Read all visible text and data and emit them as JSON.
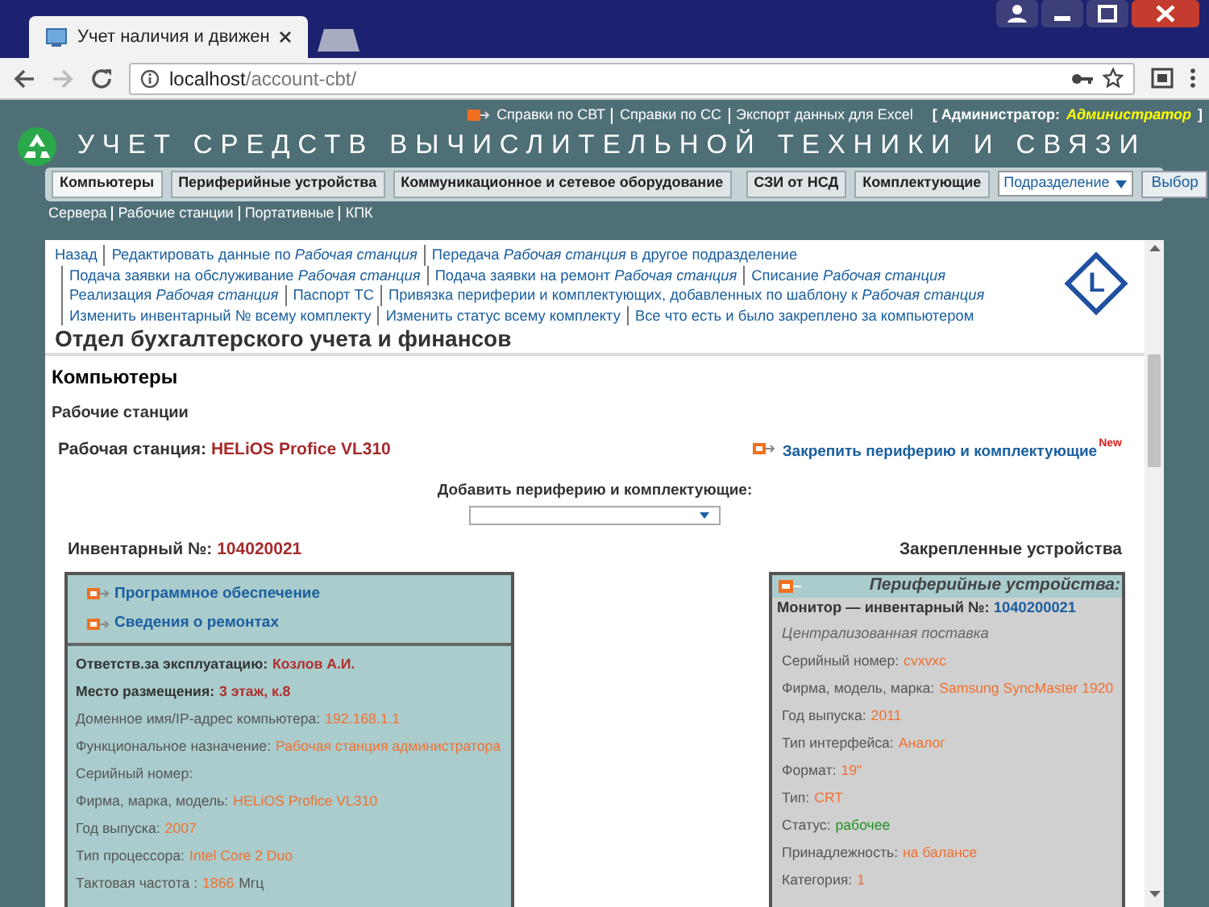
{
  "browser": {
    "tab_title": "Учет наличия и движен",
    "url_host": "localhost",
    "url_path": "/account-cbt/"
  },
  "header": {
    "top_links": [
      "Справки по СВТ",
      "Справки по СС",
      "Экспорт данных для Excel"
    ],
    "admin_label": "[ Администратор:",
    "admin_name": "Администратор",
    "admin_close": "]",
    "title": "УЧЕТ СРЕДСТВ ВЫЧИСЛИТЕЛЬНОЙ ТЕХНИКИ И СВЯЗИ",
    "nav": [
      {
        "label": "Компьютеры",
        "selected": true
      },
      {
        "label": "Периферийные устройства",
        "selected": false
      },
      {
        "label": "Коммуникационное и сетевое оборудование",
        "selected": false
      },
      {
        "label": "СЗИ от НСД",
        "selected": false
      },
      {
        "label": "Комплектующие",
        "selected": false
      }
    ],
    "department_select": "Подразделение",
    "select_button": "Выбор",
    "sublinks": [
      "Сервера",
      "Рабочие станции",
      "Портативные",
      "КПК"
    ]
  },
  "actions": [
    "Назад",
    "Редактировать данные по *Рабочая станция*",
    "Передача *Рабочая станция* в другое подразделение",
    "Подача заявки на обслуживание *Рабочая станция*",
    "Подача заявки на ремонт *Рабочая станция*",
    "Списание *Рабочая станция*",
    "Реализация *Рабочая станция*",
    "Паспорт ТС",
    "Привязка периферии и комплектующих, добавленных по шаблону к *Рабочая станция*",
    "Изменить инвентарный № всему комплекту",
    "Изменить статус всему комплекту",
    "Все что есть и было закреплено за компьютером"
  ],
  "logo_letter": "L",
  "department": "Отдел бухгалтерского учета и финансов",
  "section": "Компьютеры",
  "subsection": "Рабочие станции",
  "station_label": "Рабочая станция:",
  "station_name": "HELiOS Profice VL310",
  "attach_link": "Закрепить периферию и комплектующие",
  "attach_badge": "New",
  "add_label": "Добавить периферию и комплектующие:",
  "inventory_label": "Инвентарный №:",
  "inventory_number": "104020021",
  "attached_heading": "Закрепленные устройства",
  "computer_panel": {
    "links": [
      "Программное обеспечение",
      "Сведения о ремонтах"
    ],
    "fields": [
      {
        "label": "Ответств.за эксплуатацию:",
        "value": "Козлов А.И.",
        "kind": "bold"
      },
      {
        "label": "Место размещения:",
        "value": "3 этаж, к.8",
        "kind": "bold"
      },
      {
        "label": "Доменное имя/IP-адрес компьютера:",
        "value": "192.168.1.1",
        "kind": "plain"
      },
      {
        "label": "Функциональное назначение:",
        "value": "Рабочая станция администратора",
        "kind": "plain"
      },
      {
        "label": "Серийный номер:",
        "kind": "plain"
      },
      {
        "label": "Фирма, марка, модель:",
        "value": "HELiOS Profice VL310",
        "kind": "plain"
      },
      {
        "label": "Год выпуска:",
        "value": "2007",
        "kind": "plain"
      },
      {
        "label": "Тип процессора:",
        "value": "Intel Core 2 Duo",
        "kind": "plain"
      },
      {
        "label": "Тактовая частота :",
        "value": "1866",
        "unit": "Мгц",
        "kind": "plain"
      }
    ]
  },
  "devices_panel": {
    "title": "Периферийные устройства:",
    "device_label": "Монитор — инвентарный №:",
    "device_number": "1040200021",
    "note": "Централизованная поставка",
    "fields": [
      {
        "label": "Серийный номер:",
        "value": "cvxvxc",
        "kind": "plain"
      },
      {
        "label": "Фирма, модель, марка:",
        "value": "Samsung SyncMaster 1920",
        "kind": "plain"
      },
      {
        "label": "Год выпуска:",
        "value": "2011",
        "kind": "plain"
      },
      {
        "label": "Тип интерфейса:",
        "value": "Аналог",
        "kind": "plain"
      },
      {
        "label": "Формат:",
        "value": "19\"",
        "kind": "plain"
      },
      {
        "label": "Тип:",
        "value": "CRT",
        "kind": "plain"
      },
      {
        "label": "Статус:",
        "value": "рабочее",
        "kind": "status"
      },
      {
        "label": "Принадлежность:",
        "value": "на балансе",
        "kind": "plain"
      },
      {
        "label": "Категория:",
        "value": "1",
        "kind": "plain"
      }
    ]
  }
}
